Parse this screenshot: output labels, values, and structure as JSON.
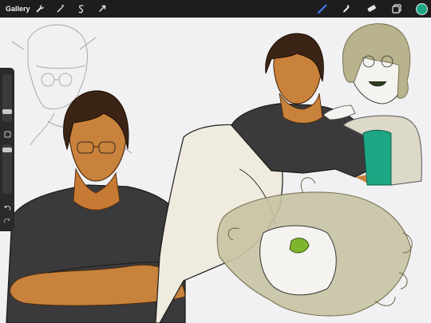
{
  "topbar": {
    "gallery_label": "Gallery",
    "left_tools": [
      {
        "icon": "wrench-icon"
      },
      {
        "icon": "magic-wand-icon"
      },
      {
        "icon": "selection-icon"
      },
      {
        "icon": "transform-arrow-icon"
      }
    ],
    "right_tools": [
      {
        "icon": "brush-icon",
        "active": true
      },
      {
        "icon": "smudge-icon"
      },
      {
        "icon": "eraser-icon"
      },
      {
        "icon": "layers-icon"
      }
    ],
    "current_color": "#1ea784",
    "accent_color": "#3b82f6"
  },
  "sidebar": {
    "size_level": 0.72,
    "opacity_level": 0.3,
    "buttons": [
      {
        "icon": "modify-square-icon"
      },
      {
        "icon": "undo-icon"
      },
      {
        "icon": "redo-icon"
      }
    ]
  }
}
